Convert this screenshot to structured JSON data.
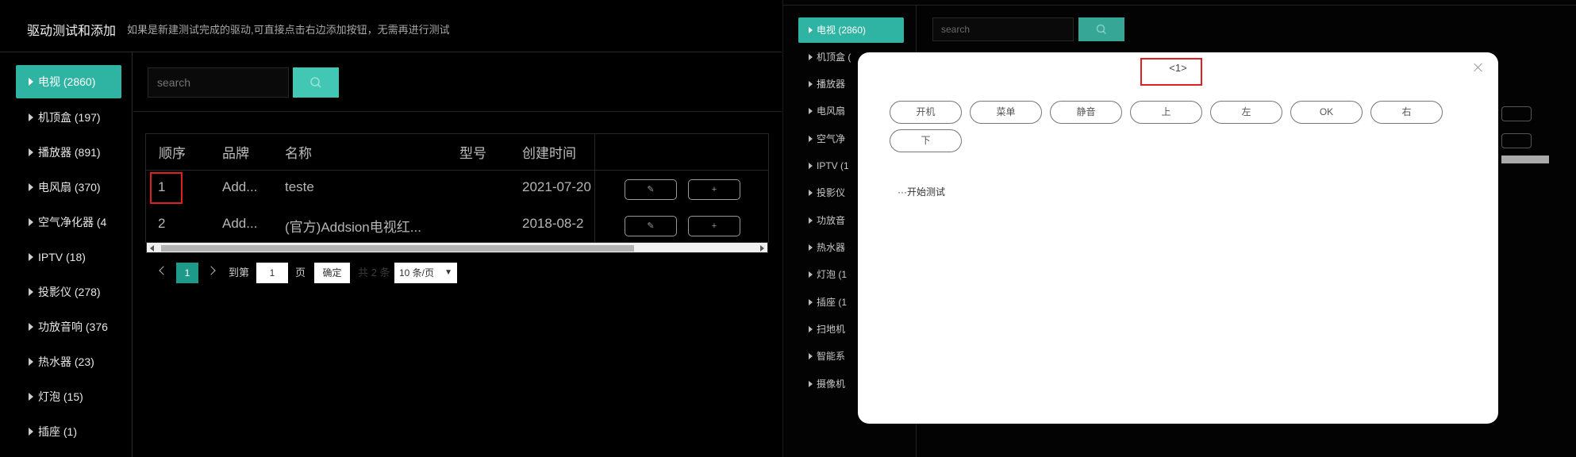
{
  "left": {
    "title": "驱动测试和添加",
    "hint": "如果是新建测试完成的驱动,可直接点击右边添加按钮，无需再进行测试",
    "categories": [
      {
        "label": "电视 (2860)"
      },
      {
        "label": "机顶盒 (197)"
      },
      {
        "label": "播放器 (891)"
      },
      {
        "label": "电风扇 (370)"
      },
      {
        "label": "空气净化器 (4"
      },
      {
        "label": "IPTV (18)"
      },
      {
        "label": "投影仪 (278)"
      },
      {
        "label": "功放音响 (376"
      },
      {
        "label": "热水器 (23)"
      },
      {
        "label": "灯泡 (15)"
      },
      {
        "label": "插座 (1)"
      }
    ],
    "search": {
      "placeholder": "search",
      "icon": "search-icon"
    },
    "table": {
      "headers": [
        "顺序",
        "品牌",
        "名称",
        "型号",
        "创建时间"
      ],
      "rows": [
        {
          "order": "1",
          "brand": "Add...",
          "name": "teste",
          "model": "",
          "created": "2021-07-20"
        },
        {
          "order": "2",
          "brand": "Add...",
          "name": "(官方)Addsion电视红...",
          "model": "",
          "created": "2018-08-2"
        }
      ],
      "row_actions": [
        "edit-icon",
        "add-icon"
      ]
    },
    "pagination": {
      "current_page": "1",
      "goto_label": "到第",
      "page_input": "1",
      "page_suffix": "页",
      "confirm_label": "确定",
      "total_label": "共 2 条",
      "page_size": "10 条/页"
    }
  },
  "right": {
    "categories": [
      {
        "label": "电视 (2860)"
      },
      {
        "label": "机顶盒 ("
      },
      {
        "label": "播放器"
      },
      {
        "label": "电风扇"
      },
      {
        "label": "空气净"
      },
      {
        "label": "IPTV (1"
      },
      {
        "label": "投影仪"
      },
      {
        "label": "功放音"
      },
      {
        "label": "热水器"
      },
      {
        "label": "灯泡 (1"
      },
      {
        "label": "插座 (1"
      },
      {
        "label": "扫地机"
      },
      {
        "label": "智能系"
      },
      {
        "label": "摄像机"
      }
    ],
    "search": {
      "placeholder": "search"
    }
  },
  "modal": {
    "title": "<1>",
    "buttons": [
      "开机",
      "菜单",
      "静音",
      "上",
      "左",
      "OK",
      "右",
      "下"
    ],
    "status": "···开始测试"
  },
  "colors": {
    "accent": "#2fb4a4",
    "highlight_box": "#e02020",
    "background": "#000000"
  }
}
